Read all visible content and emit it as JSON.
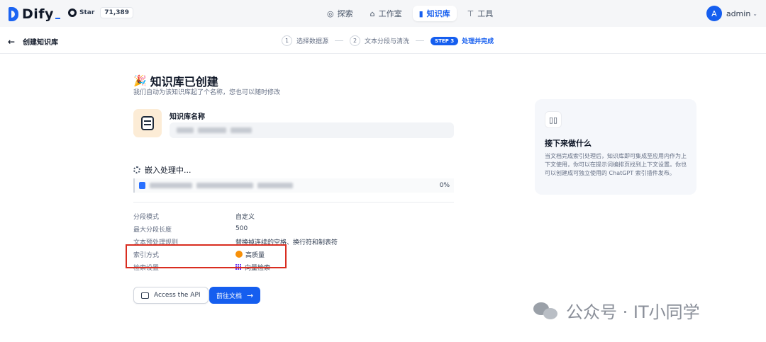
{
  "app": {
    "logo_text": "Dify"
  },
  "github": {
    "label": "Star",
    "count": "71,389"
  },
  "nav": {
    "tabs": [
      {
        "label": "探索",
        "icon": "compass-icon"
      },
      {
        "label": "工作室",
        "icon": "robot-icon"
      },
      {
        "label": "知识库",
        "icon": "book-icon",
        "active": true
      },
      {
        "label": "工具",
        "icon": "hammer-icon"
      }
    ]
  },
  "user": {
    "initial": "A",
    "name": "admin"
  },
  "subheader": {
    "back_label": "创建知识库",
    "steps": [
      {
        "num": "1",
        "label": "选择数据源"
      },
      {
        "num": "2",
        "label": "文本分段与清洗"
      },
      {
        "badge": "STEP 3",
        "label": "处理并完成",
        "active": true
      }
    ]
  },
  "main": {
    "title": "知识库已创建",
    "subtitle": "我们自动为该知识库起了个名称，您也可以随时修改",
    "kb_name_label": "知识库名称",
    "embed_title": "嵌入处理中...",
    "doc_progress": "0%",
    "info": [
      {
        "key": "分段模式",
        "value": "自定义"
      },
      {
        "key": "最大分段长度",
        "value": "500"
      },
      {
        "key": "文本预处理规则",
        "value": "替换掉连续的空格、换行符和制表符"
      },
      {
        "key": "索引方式",
        "value": "高质量",
        "icon": "quality-icon"
      },
      {
        "key": "检索设置",
        "value": "向量检索",
        "icon": "vector-icon"
      }
    ],
    "api_button": "Access the API",
    "docs_button": "前往文档"
  },
  "next": {
    "title": "接下来做什么",
    "desc": "当文档完成索引处理后，知识库即可集成至应用内作为上下文使用，你可以在提示词编排页找到上下文设置。你也可以创建成可独立使用的 ChatGPT 索引插件发布。"
  },
  "watermark": {
    "text": "公众号 · IT小同学"
  },
  "colors": {
    "accent": "#155eef",
    "highlight_box": "#d92d20"
  }
}
